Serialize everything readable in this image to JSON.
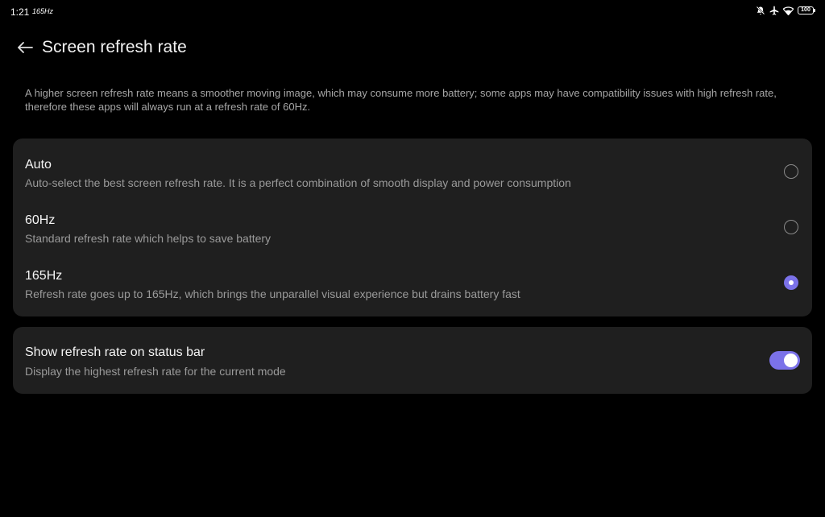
{
  "status_bar": {
    "time": "1:21",
    "refresh_indicator": "165Hz",
    "battery": "100",
    "icons": [
      "mute-icon",
      "airplane-icon",
      "wifi-icon",
      "battery-icon"
    ]
  },
  "header": {
    "back_icon": "arrow-left-icon",
    "title": "Screen refresh rate"
  },
  "description": "A higher screen refresh rate means a smoother moving image, which may consume more battery; some apps may have compatibility issues with high refresh rate, therefore these apps will always run at a refresh rate of 60Hz.",
  "options": [
    {
      "title": "Auto",
      "subtitle": "Auto-select the best screen refresh rate. It is a perfect combination of smooth display and power consumption",
      "selected": false
    },
    {
      "title": "60Hz",
      "subtitle": "Standard refresh rate which helps to save battery",
      "selected": false
    },
    {
      "title": "165Hz",
      "subtitle": "Refresh rate goes up to 165Hz, which brings the unparallel visual experience but drains battery fast",
      "selected": true
    }
  ],
  "status_bar_toggle": {
    "title": "Show refresh rate on status bar",
    "subtitle": "Display the highest refresh rate for the current mode",
    "enabled": true
  },
  "colors": {
    "accent": "#7b72e9",
    "background": "#000000",
    "card": "#1f1f1f",
    "secondary_text": "#9a9a9a"
  }
}
